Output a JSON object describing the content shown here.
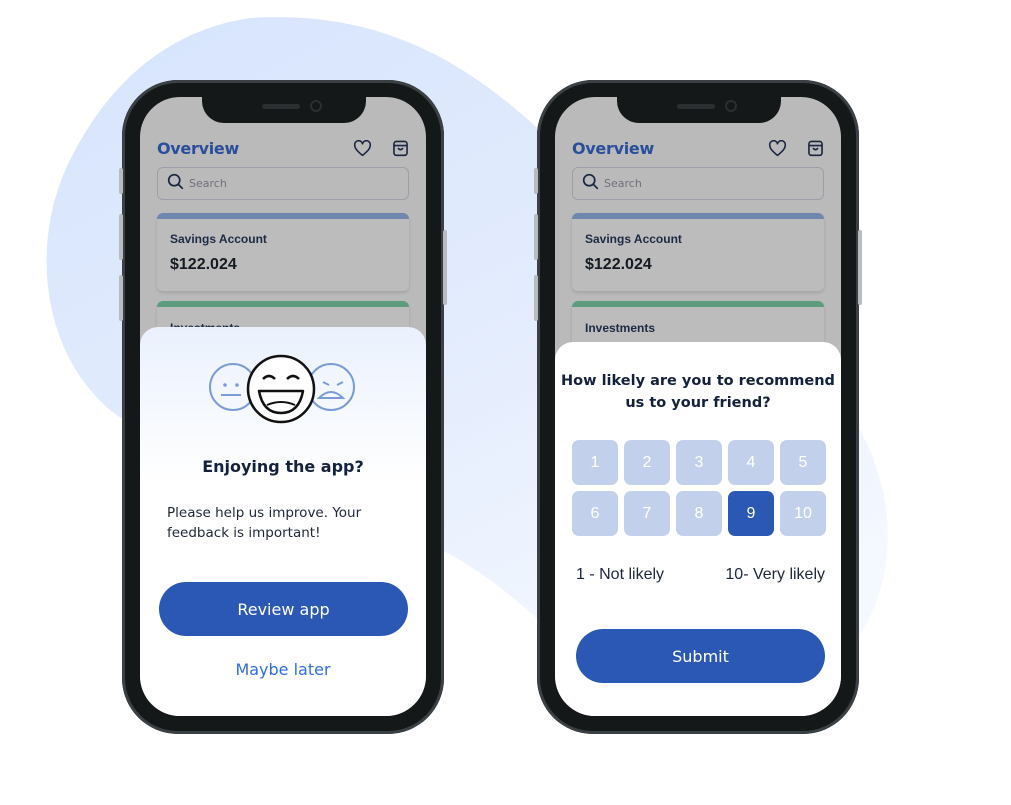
{
  "colors": {
    "brand_blue": "#2b58b4",
    "link_blue": "#2f6ee6",
    "title_blue": "#2a4e9c",
    "score_unselected": "#c2d0eb",
    "savings_stripe": "#6f86ae",
    "investments_stripe": "#5d9c7e",
    "background_blob": "#d8e5fc"
  },
  "app": {
    "title": "Overview",
    "header_icons": [
      "heart-icon",
      "shopping-bag-icon"
    ],
    "search": {
      "placeholder": "Search",
      "icon": "search-icon"
    },
    "cards": [
      {
        "label": "Savings Account",
        "amount": "$122.024"
      },
      {
        "label": "Investments"
      }
    ]
  },
  "left_phone": {
    "sheet": {
      "illustration": [
        "neutral-face-icon",
        "laughing-face-icon",
        "angry-face-icon"
      ],
      "title": "Enjoying the app?",
      "description": "Please help us improve. Your feedback is important!",
      "primary_button": "Review app",
      "secondary_link": "Maybe later"
    }
  },
  "right_phone": {
    "sheet": {
      "question": "How likely are you to recommend us to your friend?",
      "scores": [
        "1",
        "2",
        "3",
        "4",
        "5",
        "6",
        "7",
        "8",
        "9",
        "10"
      ],
      "selected_score": "9",
      "min_label": "1 - Not likely",
      "max_label": "10- Very likely",
      "submit_button": "Submit"
    }
  }
}
